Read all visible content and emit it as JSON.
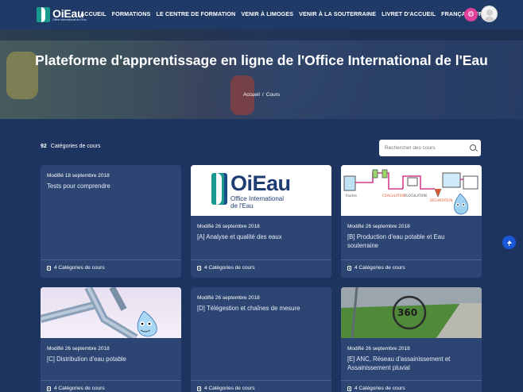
{
  "brand": {
    "name": "OiEau",
    "tagline": "Office International de l'Eau"
  },
  "nav": {
    "items": [
      "ACCUEIL",
      "FORMATIONS",
      "LE CENTRE DE FORMATION",
      "VENIR À LIMOGES",
      "VENIR À LA SOUTERRAINE",
      "LIVRET D'ACCUEIL",
      "FRANÇAIS (FR)"
    ],
    "settings_icon": "gear-icon",
    "avatar_icon": "user-avatar-icon"
  },
  "hero": {
    "title": "Plateforme d'apprentissage en ligne de l'Office International de l'Eau",
    "breadcrumb": [
      "Accueil",
      "Cours"
    ]
  },
  "toolbar": {
    "count": "92",
    "count_label": "Catégories de cours",
    "search_placeholder": "Rechercher des cours"
  },
  "cards": [
    {
      "date": "Modifié 18 septembre 2018",
      "title": "Tests pour comprendre",
      "footer": ""
    },
    {
      "date": "Modifié 26 septembre 2018",
      "title": "[A] Analyse et qualité des eaux",
      "footer": "4 Catégories de cours"
    },
    {
      "date": "Modifié 26 septembre 2018",
      "title": "[B] Production d'eau potable et Eau souterraine",
      "footer": "4 Catégories de cours"
    },
    {
      "date": "Modifié 26 septembre 2018",
      "title": "[C] Distribution d'eau potable",
      "footer": "4 Catégories de cours"
    },
    {
      "date": "Modifié 26 septembre 2018",
      "title": "[D] Télégestion et chaînes de mesure",
      "footer": "4 Catégories de cours"
    },
    {
      "date": "Modifié 26 septembre 2018",
      "title": "[E] ANC, Réseau d'assainissement et Assainissement pluvial",
      "footer": "4 Catégories de cours"
    }
  ],
  "card_first_footer": "4 Catégories de cours",
  "images": {
    "oieau_logo_name": "OiEau",
    "oieau_logo_line1": "Office International",
    "oieau_logo_line2": "de l'Eau",
    "photo_360_label": "360"
  },
  "colors": {
    "background": "#1d3461",
    "card": "#2c4572",
    "accent": "#e0409a",
    "scroll_button": "#1a56d8"
  }
}
